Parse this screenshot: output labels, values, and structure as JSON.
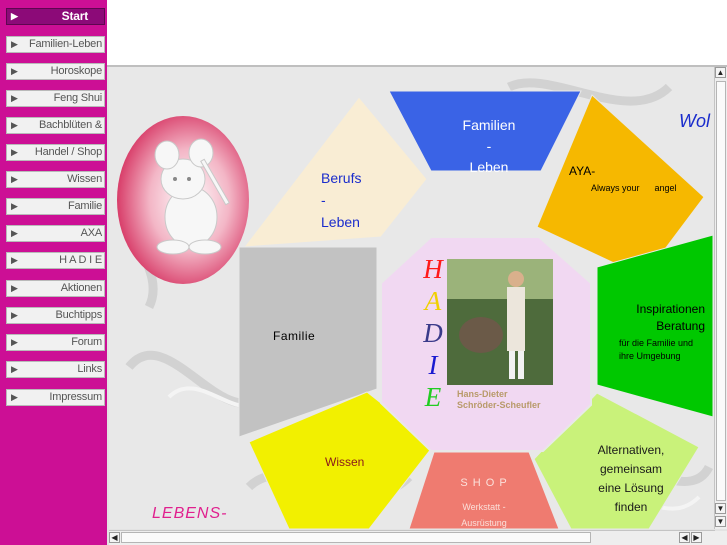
{
  "sidebar": {
    "items": [
      {
        "label": "Start",
        "active": true
      },
      {
        "label": "Familien-Leben"
      },
      {
        "label": "Horoskope"
      },
      {
        "label": "Feng Shui"
      },
      {
        "label": "Bachblüten &"
      },
      {
        "label": "Handel / Shop"
      },
      {
        "label": "Wissen"
      },
      {
        "label": "Familie"
      },
      {
        "label": "AXA"
      },
      {
        "label": "H A D I E"
      },
      {
        "label": "Aktionen"
      },
      {
        "label": "Buchtipps"
      },
      {
        "label": "Forum"
      },
      {
        "label": "Links"
      },
      {
        "label": "Impressum"
      }
    ]
  },
  "segments": {
    "familien_leben": [
      "Familien",
      "-",
      "Leben"
    ],
    "berufs_leben": [
      "Berufs",
      "-",
      "Leben"
    ],
    "aya_title": "AYA-",
    "aya_sub": "Always your      angel",
    "familie": "Familie",
    "inspirationen": [
      "Inspirationen",
      "Beratung"
    ],
    "inspirationen_sub": [
      "für die Familie und",
      "ihre Umgebung"
    ],
    "wissen": "Wissen",
    "shop": "S H O P",
    "shop_sub": [
      "Werkstatt -",
      "Ausrüstung"
    ],
    "alternativen": [
      "Alternativen,",
      "gemeinsam",
      "eine Lösung",
      "finden"
    ]
  },
  "center": {
    "letters": [
      "H",
      "A",
      "D",
      "I",
      "E"
    ],
    "letter_colors": [
      "#ff1a1a",
      "#f0d000",
      "#3a3a8a",
      "#1a1ad0",
      "#22cc22"
    ],
    "caption": [
      "Hans-Dieter",
      "Schröder-Scheufler"
    ]
  },
  "corner_text_top": "Wol",
  "corner_text_bottom": "LEBENS-",
  "colors": {
    "sidebar": "#cc0f95",
    "familien_leben": "#3a63e6",
    "aya": "#f6b800",
    "inspirationen": "#00c800",
    "alternativen": "#c9f27a",
    "shop": "#ef7b70",
    "wissen": "#f2f000",
    "familie": "#c2c2c2",
    "berufs": "#f9edd4",
    "center": "#f1d8f2"
  }
}
